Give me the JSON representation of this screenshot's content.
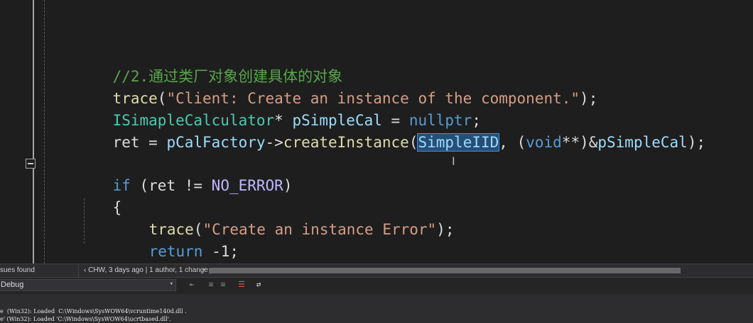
{
  "editor": {
    "comment": "//2.通过类厂对象创建具体的对象",
    "line_trace1": {
      "fn": "trace",
      "open": "(",
      "str": "\"Client: Create an instance of the component.\"",
      "close": ");"
    },
    "line_decl": {
      "type": "ISimapleCalculator",
      "star": "* ",
      "var": "pSimpleCal",
      "eq": " = ",
      "null": "nullptr",
      "semi": ";"
    },
    "line_create": {
      "lhs": "ret = ",
      "obj": "pCalFactory",
      "arrow": "->",
      "fn": "createInstance",
      "open": "(",
      "selected": "SimpleIID",
      "mid": ", (",
      "void": "void",
      "cast": "**)&",
      "var": "pSimpleCal",
      "close": ");"
    },
    "line_if": {
      "kw": "if",
      "open": " (ret != ",
      "macro": "NO_ERROR",
      "close": ")"
    },
    "brace_open": "{",
    "line_trace2": {
      "fn": "trace",
      "open": "(",
      "str": "\"Create an instance Error\"",
      "close": ");"
    },
    "line_return": {
      "kw": "return",
      "rest": " -1;"
    },
    "brace_close": "}"
  },
  "statusbar": {
    "issues": "sues found",
    "codelens": "CHW, 3 days ago | 1 author, 1 change"
  },
  "output": {
    "source_selected": "Debug",
    "lines": [
      "e  (Win32): Loaded  C:\\Windows\\SysWOW64\\vcruntime140d.dll .",
      "e' (Win32): Loaded 'C:\\Windows\\SysWOW64\\ucrtbased.dll'."
    ]
  },
  "icons": {
    "fold": "collapse-icon",
    "toolbar": [
      "find-icon",
      "prev-message-icon",
      "next-message-icon",
      "clear-all-icon",
      "word-wrap-icon"
    ]
  }
}
